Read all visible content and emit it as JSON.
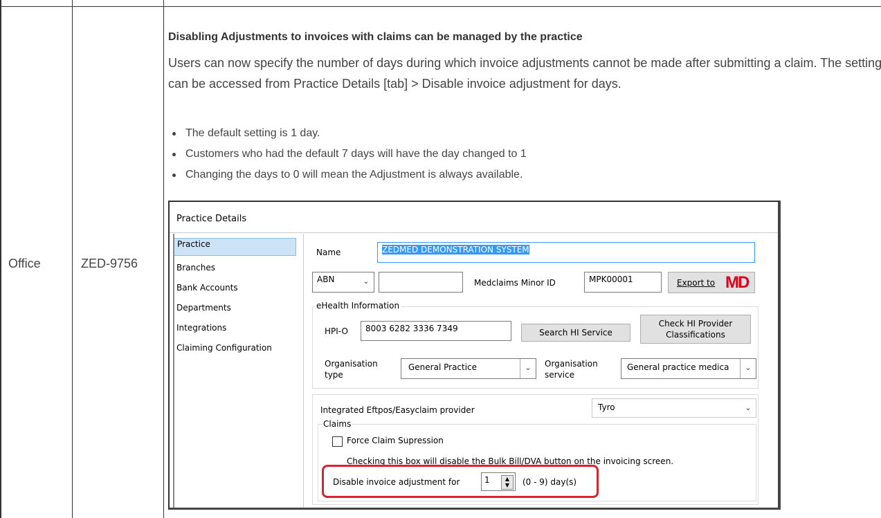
{
  "table": {
    "row_category": "Office",
    "row_id": "ZED-9756"
  },
  "article": {
    "title": "Disabling Adjustments to invoices with claims can be managed by the practice",
    "paragraph": "Users can now specify the number of days during which invoice adjustments cannot be made after submitting a claim. The setting can be accessed from Practice Details [tab] > Disable invoice adjustment for days.",
    "bullets": [
      "The default setting is 1 day.",
      "Customers who had the default 7 days will have the day changed to 1",
      "Changing the days to 0 will mean the Adjustment is always available."
    ]
  },
  "dialog": {
    "title": "Practice Details",
    "sidebar": [
      "Practice",
      "Branches",
      "Bank Accounts",
      "Departments",
      "Integrations",
      "Claiming Configuration"
    ],
    "name_label": "Name",
    "name_value": "ZEDMED DEMONSTRATION SYSTEM",
    "abn_select": "ABN",
    "abn_value": "",
    "medclaims_label": "Medclaims Minor ID",
    "medclaims_value": "MPK00001",
    "export_label": "Export to",
    "export_logo": "MD",
    "ehealth_group": "eHealth Information",
    "hpio_label": "HPI-O",
    "hpio_value": "8003 6282 3336 7349",
    "search_button": "Search HI Service",
    "check_button_line1": "Check HI Provider",
    "check_button_line2": "Classifications",
    "org_type_label_1": "Organisation",
    "org_type_label_2": "type",
    "org_type_value": "General Practice",
    "org_service_label_1": "Organisation",
    "org_service_label_2": "service",
    "org_service_value": "General practice medica",
    "eftpos_label": "Integrated Eftpos/Easyclaim provider",
    "eftpos_value": "Tyro",
    "claims_group": "Claims",
    "force_claim_label": "Force Claim Supression",
    "force_claim_checked": false,
    "checking_note": "Checking this box will disable the Bulk Bill/DVA button on the invoicing screen.",
    "disable_label": "Disable invoice adjustment for",
    "disable_value": "1",
    "disable_range": "(0 - 9) day(s)"
  },
  "colors": {
    "highlight": "#d9232e",
    "selection": "#3399ff",
    "logo": "#e1001a"
  }
}
